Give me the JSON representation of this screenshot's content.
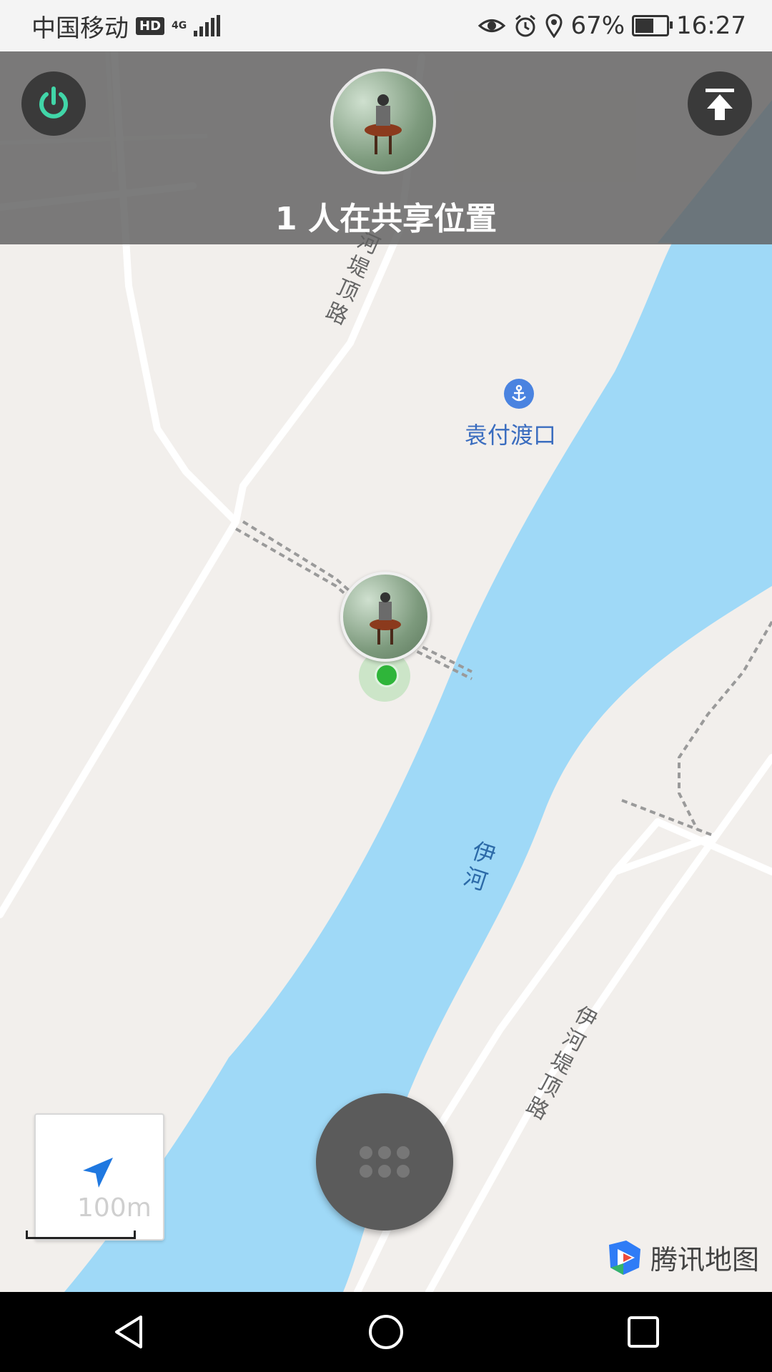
{
  "status_bar": {
    "carrier": "中国移动",
    "hd_badge": "HD",
    "network": "4G",
    "battery_percent": "67%",
    "battery_level": 0.67,
    "time": "16:27"
  },
  "header": {
    "share_count_text": "1 人在共享位置"
  },
  "map": {
    "poi_name": "袁付渡口",
    "river_name": "伊河",
    "road_label_upper": "河堤顶路",
    "road_label_lower": "伊河堤顶路"
  },
  "controls": {
    "scale_label": "100m"
  },
  "brand": {
    "name": "腾讯地图"
  },
  "colors": {
    "river": "#9fd9f7",
    "land": "#f2efec",
    "road": "#ffffff",
    "accent_green": "#2fb53a",
    "power_icon": "#41d6a8",
    "poi_blue": "#4a83e0"
  },
  "icons": {
    "power": "power-icon",
    "move_top": "move-to-top-icon",
    "locate": "navigation-arrow-icon",
    "anchor": "anchor-icon",
    "menu": "grid-dots-icon"
  }
}
